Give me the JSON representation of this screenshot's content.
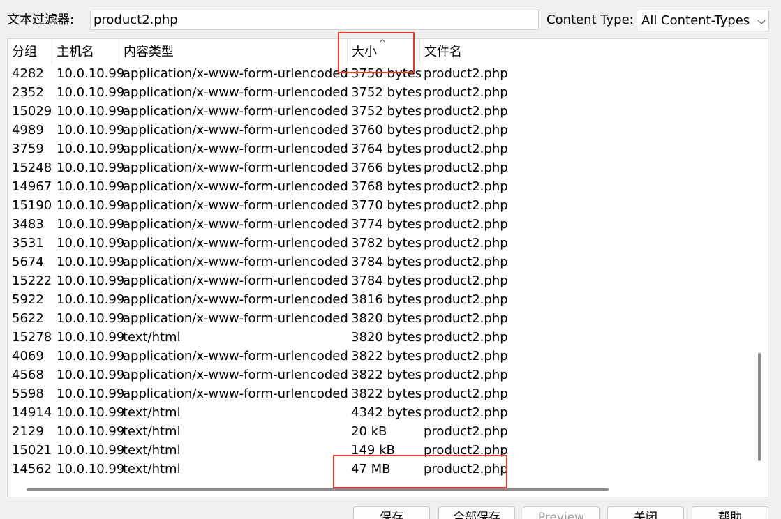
{
  "filter": {
    "label": "文本过滤器:",
    "value": "product2.php"
  },
  "content_type": {
    "label": "Content Type:",
    "selected": "All Content-Types"
  },
  "table": {
    "columns": [
      "分组",
      "主机名",
      "内容类型",
      "大小",
      "文件名"
    ],
    "sort_column": "大小",
    "sort_indicator": "^",
    "rows": [
      [
        "4282",
        "10.0.10.99",
        "application/x-www-form-urlencoded",
        "3750 bytes",
        "product2.php"
      ],
      [
        "2352",
        "10.0.10.99",
        "application/x-www-form-urlencoded",
        "3752 bytes",
        "product2.php"
      ],
      [
        "15029",
        "10.0.10.99",
        "application/x-www-form-urlencoded",
        "3752 bytes",
        "product2.php"
      ],
      [
        "4989",
        "10.0.10.99",
        "application/x-www-form-urlencoded",
        "3760 bytes",
        "product2.php"
      ],
      [
        "3759",
        "10.0.10.99",
        "application/x-www-form-urlencoded",
        "3764 bytes",
        "product2.php"
      ],
      [
        "15248",
        "10.0.10.99",
        "application/x-www-form-urlencoded",
        "3766 bytes",
        "product2.php"
      ],
      [
        "14967",
        "10.0.10.99",
        "application/x-www-form-urlencoded",
        "3768 bytes",
        "product2.php"
      ],
      [
        "15190",
        "10.0.10.99",
        "application/x-www-form-urlencoded",
        "3770 bytes",
        "product2.php"
      ],
      [
        "3483",
        "10.0.10.99",
        "application/x-www-form-urlencoded",
        "3774 bytes",
        "product2.php"
      ],
      [
        "3531",
        "10.0.10.99",
        "application/x-www-form-urlencoded",
        "3782 bytes",
        "product2.php"
      ],
      [
        "5674",
        "10.0.10.99",
        "application/x-www-form-urlencoded",
        "3784 bytes",
        "product2.php"
      ],
      [
        "15222",
        "10.0.10.99",
        "application/x-www-form-urlencoded",
        "3784 bytes",
        "product2.php"
      ],
      [
        "5922",
        "10.0.10.99",
        "application/x-www-form-urlencoded",
        "3816 bytes",
        "product2.php"
      ],
      [
        "5622",
        "10.0.10.99",
        "application/x-www-form-urlencoded",
        "3820 bytes",
        "product2.php"
      ],
      [
        "15278",
        "10.0.10.99",
        "text/html",
        "3820 bytes",
        "product2.php"
      ],
      [
        "4069",
        "10.0.10.99",
        "application/x-www-form-urlencoded",
        "3822 bytes",
        "product2.php"
      ],
      [
        "4568",
        "10.0.10.99",
        "application/x-www-form-urlencoded",
        "3822 bytes",
        "product2.php"
      ],
      [
        "5598",
        "10.0.10.99",
        "application/x-www-form-urlencoded",
        "3822 bytes",
        "product2.php"
      ],
      [
        "14914",
        "10.0.10.99",
        "text/html",
        "4342 bytes",
        "product2.php"
      ],
      [
        "2129",
        "10.0.10.99",
        "text/html",
        "20 kB",
        "product2.php"
      ],
      [
        "15021",
        "10.0.10.99",
        "text/html",
        "149 kB",
        "product2.php"
      ],
      [
        "14562",
        "10.0.10.99",
        "text/html",
        "47 MB",
        "product2.php"
      ]
    ]
  },
  "buttons": {
    "save": "保存",
    "save_all": "全部保存",
    "preview": "Preview",
    "close": "关闭",
    "help": "帮助"
  },
  "colors": {
    "highlight": "#e53b2c"
  }
}
